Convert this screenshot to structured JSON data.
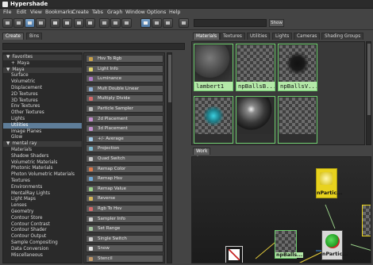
{
  "window": {
    "title": "Hypershade"
  },
  "menu": [
    "File",
    "Edit",
    "View",
    "Bookmarks",
    "Create",
    "Tabs",
    "Graph",
    "Window",
    "Options",
    "Help"
  ],
  "toolbar": {
    "show_label": "Show"
  },
  "left_tabs": [
    "Create",
    "Bins"
  ],
  "tree": [
    {
      "label": "Favorites",
      "kind": "header",
      "prefix": "▼"
    },
    {
      "label": "Maya",
      "kind": "item",
      "prefix": "+"
    },
    {
      "label": "Maya",
      "kind": "header",
      "prefix": "▼"
    },
    {
      "label": "Surface",
      "kind": "item"
    },
    {
      "label": "Volumetric",
      "kind": "item"
    },
    {
      "label": "Displacement",
      "kind": "item"
    },
    {
      "label": "2D Textures",
      "kind": "item"
    },
    {
      "label": "3D Textures",
      "kind": "item"
    },
    {
      "label": "Env Textures",
      "kind": "item"
    },
    {
      "label": "Other Textures",
      "kind": "item"
    },
    {
      "label": "Lights",
      "kind": "item"
    },
    {
      "label": "Utilities",
      "kind": "selected"
    },
    {
      "label": "Image Planes",
      "kind": "item"
    },
    {
      "label": "Glow",
      "kind": "item"
    },
    {
      "label": "mental ray",
      "kind": "header",
      "prefix": "▼"
    },
    {
      "label": "Materials",
      "kind": "item"
    },
    {
      "label": "Shadow Shaders",
      "kind": "item"
    },
    {
      "label": "Volumetric Materials",
      "kind": "item"
    },
    {
      "label": "Photonic Materials",
      "kind": "item"
    },
    {
      "label": "Photon Volumetric Materials",
      "kind": "item"
    },
    {
      "label": "Textures",
      "kind": "item"
    },
    {
      "label": "Environments",
      "kind": "item"
    },
    {
      "label": "MentalRay Lights",
      "kind": "item"
    },
    {
      "label": "Light Maps",
      "kind": "item"
    },
    {
      "label": "Lenses",
      "kind": "item"
    },
    {
      "label": "Geometry",
      "kind": "item"
    },
    {
      "label": "Contour Store",
      "kind": "item"
    },
    {
      "label": "Contour Contrast",
      "kind": "item"
    },
    {
      "label": "Contour Shader",
      "kind": "item"
    },
    {
      "label": "Contour Output",
      "kind": "item"
    },
    {
      "label": "Sample Compositing",
      "kind": "item"
    },
    {
      "label": "Data Conversion",
      "kind": "item"
    },
    {
      "label": "Miscellaneous",
      "kind": "item"
    }
  ],
  "nodes": [
    {
      "label": "Hsv To Rgb",
      "icon": "#c9a24a"
    },
    {
      "label": "Light Info",
      "icon": "#e0d46a"
    },
    {
      "label": "Luminance",
      "icon": "#b07ac8"
    },
    {
      "label": "Mult Double Linear",
      "icon": "#8fb0d8"
    },
    {
      "label": "Multiply Divide",
      "icon": "#d86a6a"
    },
    {
      "label": "Particle Sampler",
      "icon": "#b9b9b9"
    },
    {
      "label": "2d Placement",
      "icon": "#c58ed0"
    },
    {
      "label": "3d Placement",
      "icon": "#c58ed0"
    },
    {
      "label": "+/- Average",
      "icon": "#9fc9e8"
    },
    {
      "label": "Projection",
      "icon": "#7bbbd1"
    },
    {
      "label": "Quad Switch",
      "icon": "#c8c8c8"
    },
    {
      "label": "Remap Color",
      "icon": "#e07a4a"
    },
    {
      "label": "Remap Hsv",
      "icon": "#6fa9d9"
    },
    {
      "label": "Remap Value",
      "icon": "#9bd38a"
    },
    {
      "label": "Reverse",
      "icon": "#d8b85a"
    },
    {
      "label": "Rgb To Hsv",
      "icon": "#d86a6a"
    },
    {
      "label": "Sampler Info",
      "icon": "#d0d0d0"
    },
    {
      "label": "Set Range",
      "icon": "#a4c7a0"
    },
    {
      "label": "Single Switch",
      "icon": "#d0d0d0"
    },
    {
      "label": "Snow",
      "icon": "#e6e6e6"
    },
    {
      "label": "Stencil",
      "icon": "#c39a6a"
    }
  ],
  "top_tabs": [
    "Materials",
    "Textures",
    "Utilities",
    "Lights",
    "Cameras",
    "Shading Groups"
  ],
  "swatches": [
    {
      "label": "lambert1",
      "kind": "sphere"
    },
    {
      "label": "npBallsB...",
      "kind": "checker"
    },
    {
      "label": "npBallsV...",
      "kind": "blur"
    },
    {
      "label": "",
      "kind": "cyan"
    },
    {
      "label": "",
      "kind": "glossy"
    },
    {
      "label": "",
      "kind": "checker"
    }
  ],
  "work_tab": "Work Area",
  "work_nodes": [
    "nPartic...",
    "nPartic...",
    "npBalls..."
  ],
  "colors": {
    "accent_green": "#b4e8a8",
    "selection": "#5e7d99",
    "node_yellow": "#e8d21e"
  }
}
